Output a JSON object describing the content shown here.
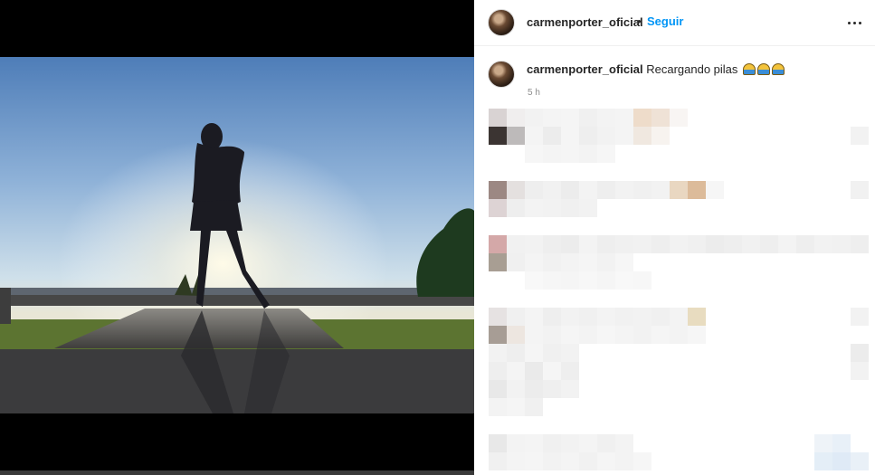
{
  "post": {
    "username": "carmenporter_oficial",
    "separator": "•",
    "follow_label": "Seguir",
    "caption": "Recargando pilas",
    "caption_emoji": "sunrise-emoji",
    "time_ago": "5 h"
  },
  "icons": {
    "more": "more-options-icon"
  },
  "colors": {
    "accent": "#0095f6",
    "text": "#262626",
    "muted": "#8e8e8e"
  }
}
